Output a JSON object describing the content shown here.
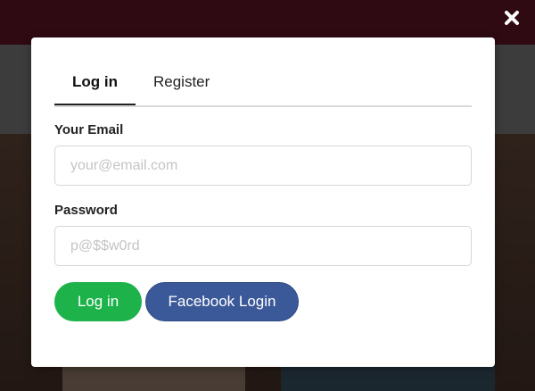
{
  "colors": {
    "login_button": "#1db34a",
    "facebook_button": "#3b5998",
    "top_bar": "#3a0d17"
  },
  "close": {
    "icon": "close-icon"
  },
  "tabs": [
    {
      "label": "Log in",
      "active": true
    },
    {
      "label": "Register",
      "active": false
    }
  ],
  "form": {
    "email_label": "Your Email",
    "email_placeholder": "your@email.com",
    "email_value": "",
    "password_label": "Password",
    "password_placeholder": "p@$$w0rd",
    "password_value": ""
  },
  "buttons": {
    "login_label": "Log in",
    "facebook_label": "Facebook Login"
  }
}
